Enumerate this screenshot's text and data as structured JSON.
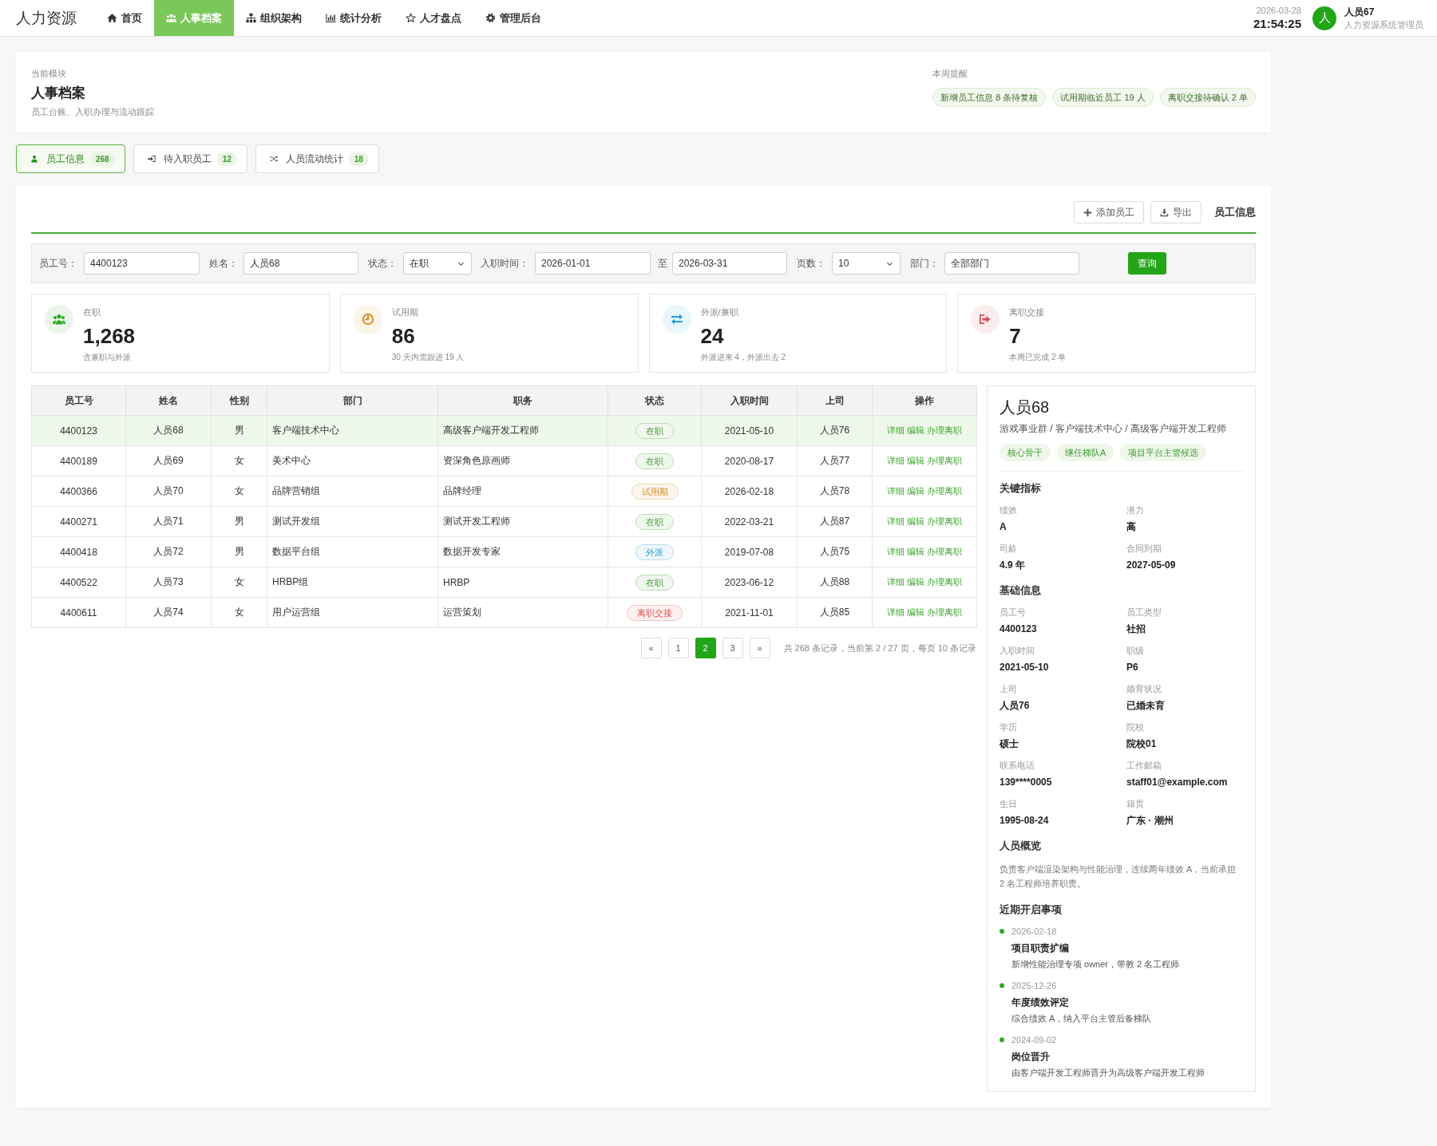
{
  "topbar": {
    "logo": "人力资源",
    "nav": [
      {
        "label": "首页",
        "selected": false
      },
      {
        "label": "人事档案",
        "selected": true
      },
      {
        "label": "组织架构",
        "selected": false
      },
      {
        "label": "统计分析",
        "selected": false
      },
      {
        "label": "人才盘点",
        "selected": false
      },
      {
        "label": "管理后台",
        "selected": false
      }
    ],
    "date": "2026-03-28",
    "time": "21:54:25",
    "user": {
      "avatar": "人",
      "name": "人员67",
      "role": "人力资源系统管理员"
    }
  },
  "module": {
    "caption": "当前模块",
    "title": "人事档案",
    "subtitle": "员工台账、入职办理与流动跟踪",
    "reminders_title": "本周提醒",
    "reminders": [
      "新增员工信息 8 条待复核",
      "试用期临近员工 19 人",
      "离职交接待确认 2 单"
    ]
  },
  "tabs": [
    {
      "label": "员工信息",
      "count": "268",
      "selected": true
    },
    {
      "label": "待入职员工",
      "count": "12",
      "selected": false
    },
    {
      "label": "人员流动统计",
      "count": "18",
      "selected": false
    }
  ],
  "toolbar": {
    "buttons": [
      "添加员工",
      "导出"
    ],
    "title": "员工信息"
  },
  "filters": {
    "fields": [
      {
        "label": "员工号：",
        "kind": "input",
        "value": "4400123"
      },
      {
        "label": "姓名：",
        "kind": "input",
        "value": "人员68"
      },
      {
        "label": "状态：",
        "kind": "select",
        "value": "在职"
      },
      {
        "label": "入职时间：",
        "kind": "input",
        "value": "2026-01-01"
      },
      {
        "label": "至",
        "kind": "input",
        "value": "2026-03-31"
      },
      {
        "label": "页数：",
        "kind": "select",
        "value": "10"
      },
      {
        "label": "部门：",
        "kind": "input",
        "value": "全部部门"
      }
    ],
    "submit": "查询"
  },
  "stats": [
    {
      "kind": "active",
      "label": "在职",
      "value": "1,268",
      "note": "含兼职与外派"
    },
    {
      "kind": "probation",
      "label": "试用期",
      "value": "86",
      "note": "30 天内需跟进 19 人"
    },
    {
      "kind": "assignment",
      "label": "外派/兼职",
      "value": "24",
      "note": "外派进来 4，外派出去 2"
    },
    {
      "kind": "offboarding",
      "label": "离职交接",
      "value": "7",
      "note": "本周已完成 2 单"
    }
  ],
  "table": {
    "columns": [
      "员工号",
      "姓名",
      "性别",
      "部门",
      "职务",
      "状态",
      "入职时间",
      "上司",
      "操作"
    ],
    "rows": [
      {
        "id": "4400123",
        "name": "人员68",
        "gender": "男",
        "department": "客户端技术中心",
        "position": "高级客户端开发工程师",
        "status": {
          "label": "在职",
          "kind": "active"
        },
        "hire_date": "2021-05-10",
        "manager": "人员76",
        "actions": [
          "详细",
          "编辑",
          "办理离职"
        ],
        "selected": true
      },
      {
        "id": "4400189",
        "name": "人员69",
        "gender": "女",
        "department": "美术中心",
        "position": "资深角色原画师",
        "status": {
          "label": "在职",
          "kind": "active"
        },
        "hire_date": "2020-08-17",
        "manager": "人员77",
        "actions": [
          "详细",
          "编辑",
          "办理离职"
        ],
        "selected": false
      },
      {
        "id": "4400366",
        "name": "人员70",
        "gender": "女",
        "department": "品牌营销组",
        "position": "品牌经理",
        "status": {
          "label": "试用期",
          "kind": "probation"
        },
        "hire_date": "2026-02-18",
        "manager": "人员78",
        "actions": [
          "详细",
          "编辑",
          "办理离职"
        ],
        "selected": false
      },
      {
        "id": "4400271",
        "name": "人员71",
        "gender": "男",
        "department": "测试开发组",
        "position": "测试开发工程师",
        "status": {
          "label": "在职",
          "kind": "active"
        },
        "hire_date": "2022-03-21",
        "manager": "人员87",
        "actions": [
          "详细",
          "编辑",
          "办理离职"
        ],
        "selected": false
      },
      {
        "id": "4400418",
        "name": "人员72",
        "gender": "男",
        "department": "数据平台组",
        "position": "数据开发专家",
        "status": {
          "label": "外派",
          "kind": "assignment"
        },
        "hire_date": "2019-07-08",
        "manager": "人员75",
        "actions": [
          "详细",
          "编辑",
          "办理离职"
        ],
        "selected": false
      },
      {
        "id": "4400522",
        "name": "人员73",
        "gender": "女",
        "department": "HRBP组",
        "position": "HRBP",
        "status": {
          "label": "在职",
          "kind": "active"
        },
        "hire_date": "2023-06-12",
        "manager": "人员88",
        "actions": [
          "详细",
          "编辑",
          "办理离职"
        ],
        "selected": false
      },
      {
        "id": "4400611",
        "name": "人员74",
        "gender": "女",
        "department": "用户运营组",
        "position": "运营策划",
        "status": {
          "label": "离职交接",
          "kind": "offboarding"
        },
        "hire_date": "2021-11-01",
        "manager": "人员85",
        "actions": [
          "详细",
          "编辑",
          "办理离职"
        ],
        "selected": false
      }
    ]
  },
  "pagination": {
    "prev": "«",
    "pages": [
      {
        "label": "1",
        "selected": false
      },
      {
        "label": "2",
        "selected": true
      },
      {
        "label": "3",
        "selected": false
      }
    ],
    "next": "»",
    "summary": "共 268 条记录，当前第 2 / 27 页，每页 10 条记录"
  },
  "detail": {
    "name": "人员68",
    "path": "游戏事业群 / 客户端技术中心 / 高级客户端开发工程师",
    "tags": [
      "核心骨干",
      "继任梯队A",
      "项目平台主管候选"
    ],
    "sections": [
      {
        "kind": "fields",
        "title": "关键指标",
        "fields": [
          {
            "label": "绩效",
            "value": "A"
          },
          {
            "label": "潜力",
            "value": "高"
          },
          {
            "label": "司龄",
            "value": "4.9 年"
          },
          {
            "label": "合同到期",
            "value": "2027-05-09"
          }
        ]
      },
      {
        "kind": "fields",
        "title": "基础信息",
        "fields": [
          {
            "label": "员工号",
            "value": "4400123"
          },
          {
            "label": "员工类型",
            "value": "社招"
          },
          {
            "label": "入职时间",
            "value": "2021-05-10"
          },
          {
            "label": "职级",
            "value": "P6"
          },
          {
            "label": "上司",
            "value": "人员76"
          },
          {
            "label": "婚育状况",
            "value": "已婚未育"
          },
          {
            "label": "学历",
            "value": "硕士"
          },
          {
            "label": "院校",
            "value": "院校01"
          },
          {
            "label": "联系电话",
            "value": "139****0005"
          },
          {
            "label": "工作邮箱",
            "value": "staff01@example.com"
          },
          {
            "label": "生日",
            "value": "1995-08-24"
          },
          {
            "label": "籍贯",
            "value": "广东 · 潮州"
          }
        ]
      },
      {
        "kind": "text",
        "title": "人员概览",
        "text": "负责客户端渲染架构与性能治理，连续两年绩效 A，当前承担 2 名工程师培养职责。"
      },
      {
        "kind": "timeline",
        "title": "近期开启事项",
        "items": [
          {
            "date": "2026-02-18",
            "title": "项目职责扩编",
            "desc": "新增性能治理专项 owner，带教 2 名工程师"
          },
          {
            "date": "2025-12-26",
            "title": "年度绩效评定",
            "desc": "综合绩效 A，纳入平台主管后备梯队"
          },
          {
            "date": "2024-09-02",
            "title": "岗位晋升",
            "desc": "由客户端开发工程师晋升为高级客户端开发工程师"
          }
        ]
      }
    ]
  }
}
